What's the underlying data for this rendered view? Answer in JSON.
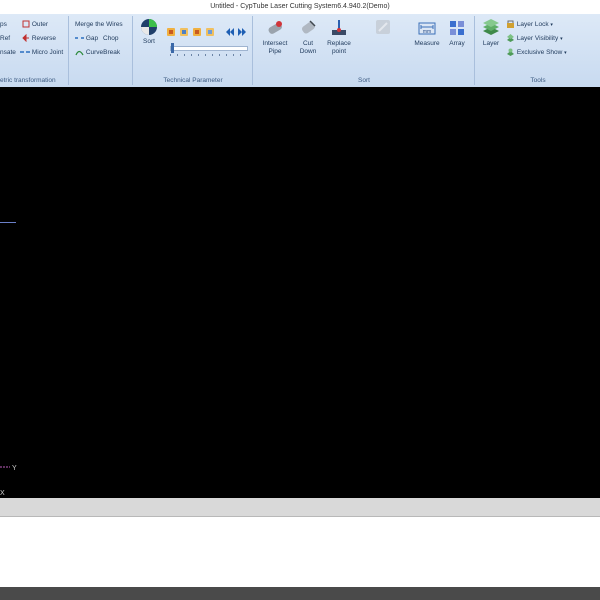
{
  "window": {
    "title": "Untitled - CypTube Laser Cutting System6.4.940.2(Demo)"
  },
  "ribbon": {
    "geometric": {
      "label": "etric transformation",
      "items": [
        {
          "label": "ps"
        },
        {
          "label": "Outer"
        },
        {
          "label": "Ref"
        },
        {
          "label": "Reverse"
        },
        {
          "label": "nsate"
        },
        {
          "label": "Micro Joint"
        }
      ]
    },
    "wires": {
      "items": [
        {
          "label": "Merge the Wires"
        },
        {
          "label": "Gap"
        },
        {
          "label": "Chop"
        },
        {
          "label": "CurveBreak"
        }
      ]
    },
    "technical": {
      "label": "Technical Parameter",
      "sort_label": "Sort"
    },
    "sort_group": {
      "label": "Sort",
      "buttons": [
        {
          "label": "Intersect\nPipe"
        },
        {
          "label": "Cut\nDown"
        },
        {
          "label": "Replace\npoint"
        },
        {
          "label": ""
        }
      ]
    },
    "tools": {
      "label": "Tools",
      "measure_label": "Measure",
      "array_label": "Array",
      "layer_label": "Layer",
      "layer_lock": "Layer Lock",
      "layer_visibility": "Layer Visibility",
      "exclusive_show": "Exclusive Show"
    }
  },
  "canvas": {
    "axis_y": "Y",
    "axis_x": "X"
  },
  "colors": {
    "canvas": "#000000",
    "ribbon": "#d5e3f4",
    "accent_blue": "#1e5fb4"
  }
}
